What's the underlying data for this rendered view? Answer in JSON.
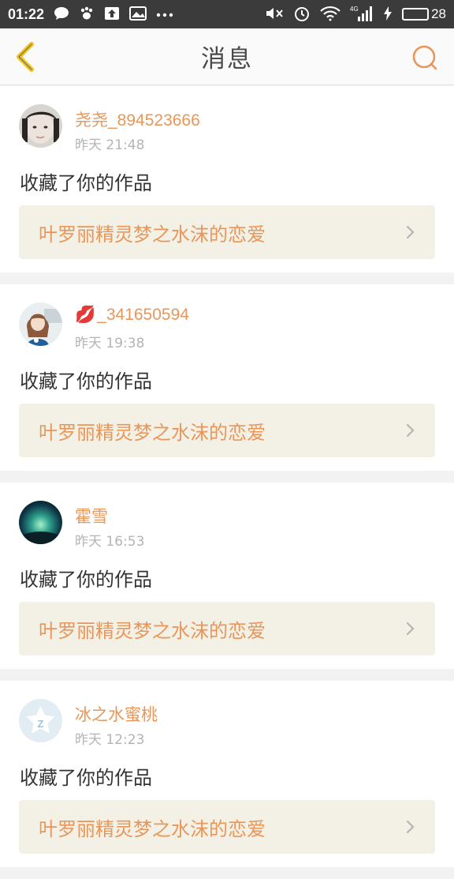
{
  "statusbar": {
    "time": "01:22",
    "battery_pct": "28",
    "network": "4G"
  },
  "header": {
    "title": "消息"
  },
  "colors": {
    "accent": "#e8965a",
    "back_arrow": "#f0c419",
    "battery": "#4cd964",
    "lips": "#d0243a"
  },
  "messages": [
    {
      "username": "尧尧_894523666",
      "time": "昨天 21:48",
      "action": "收藏了你的作品",
      "work_title": "叶罗丽精灵梦之水沫的恋爱",
      "avatar": "girl-photo-avatar"
    },
    {
      "username_prefix": "💋",
      "username": "_341650594",
      "time": "昨天 19:38",
      "action": "收藏了你的作品",
      "work_title": "叶罗丽精灵梦之水沫的恋爱",
      "avatar": "doll-photo-avatar"
    },
    {
      "username": "霍雪",
      "time": "昨天 16:53",
      "action": "收藏了你的作品",
      "work_title": "叶罗丽精灵梦之水沫的恋爱",
      "avatar": "aurora-photo-avatar"
    },
    {
      "username": "冰之水蜜桃",
      "time": "昨天 12:23",
      "action": "收藏了你的作品",
      "work_title": "叶罗丽精灵梦之水沫的恋爱",
      "avatar": "default-qq-avatar"
    }
  ]
}
